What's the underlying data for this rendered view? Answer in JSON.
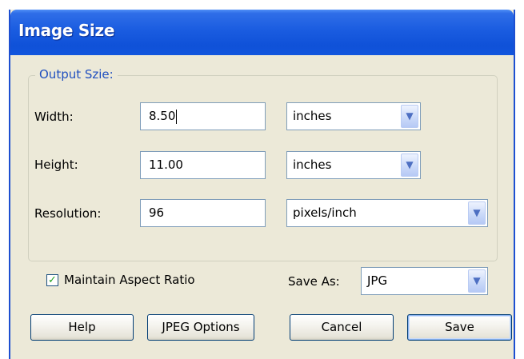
{
  "dialog": {
    "title": "Image Size"
  },
  "output_group": {
    "legend": "Output Szie:",
    "width": {
      "label": "Width:",
      "value": "8.50",
      "unit": "inches"
    },
    "height": {
      "label": "Height:",
      "value": "11.00",
      "unit": "inches"
    },
    "resolution": {
      "label": "Resolution:",
      "value": "96",
      "unit": "pixels/inch"
    }
  },
  "options": {
    "maintain_aspect": {
      "label": "Maintain Aspect Ratio",
      "checked": true,
      "check_glyph": "✓"
    },
    "save_as": {
      "label": "Save As:",
      "value": "JPG"
    }
  },
  "buttons": {
    "help": "Help",
    "jpeg_options": "JPEG Options",
    "cancel": "Cancel",
    "save": "Save"
  },
  "icons": {
    "dropdown_arrow": "chevron-down-icon",
    "arrow_glyph": "▼"
  },
  "colors": {
    "titlebar": "#0f51d8",
    "dialog_bg": "#ece9d8",
    "legend_text": "#1f4fbf",
    "check_mark": "#21a121"
  }
}
